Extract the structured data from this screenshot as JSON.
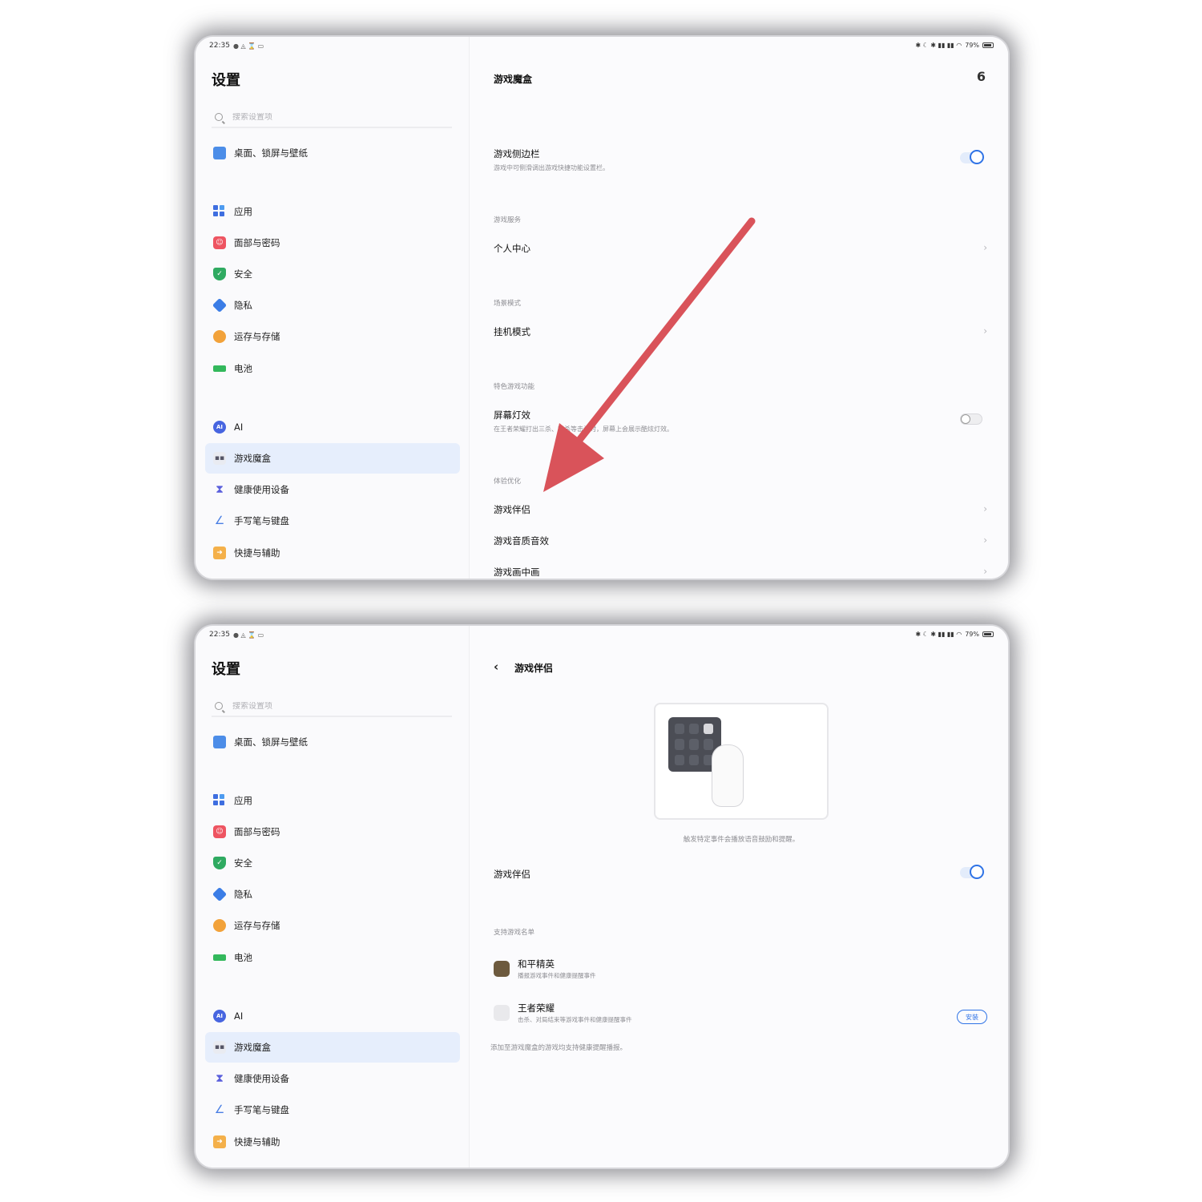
{
  "status": {
    "time": "22:35",
    "battery": "79%"
  },
  "sidebar": {
    "title": "设置",
    "search_placeholder": "搜索设置项",
    "items": [
      {
        "label": "桌面、锁屏与壁纸",
        "icon": "wallpaper-icon"
      },
      {
        "label": "应用",
        "icon": "apps-icon"
      },
      {
        "label": "面部与密码",
        "icon": "face-icon"
      },
      {
        "label": "安全",
        "icon": "shield-icon"
      },
      {
        "label": "隐私",
        "icon": "privacy-icon"
      },
      {
        "label": "运存与存储",
        "icon": "storage-icon"
      },
      {
        "label": "电池",
        "icon": "battery-icon"
      },
      {
        "label": "AI",
        "icon": "ai-icon"
      },
      {
        "label": "游戏魔盒",
        "icon": "gamepad-icon"
      },
      {
        "label": "健康使用设备",
        "icon": "hourglass-icon"
      },
      {
        "label": "手写笔与键盘",
        "icon": "pen-icon"
      },
      {
        "label": "快捷与辅助",
        "icon": "assist-icon"
      }
    ],
    "active": "游戏魔盒",
    "ai_badge": "AI"
  },
  "screen1": {
    "title": "游戏魔盒",
    "header_icon": "6",
    "sidebar_row": {
      "title": "游戏侧边栏",
      "sub": "游戏中可侧滑调出游戏快捷功能设置栏。",
      "toggle": "on"
    },
    "section_service": "游戏服务",
    "personal_center": "个人中心",
    "section_scene": "场景模式",
    "afk_mode": "挂机模式",
    "section_feature": "特色游戏功能",
    "screen_light": {
      "title": "屏幕灯效",
      "sub": "在王者荣耀打出三杀、四杀等击杀时，屏幕上会展示酷炫灯效。",
      "toggle": "off"
    },
    "section_experience": "体验优化",
    "companion": "游戏伴侣",
    "audio": "游戏音质音效",
    "picture": "游戏画中画"
  },
  "screen2": {
    "title": "游戏伴侣",
    "caption": "触发特定事件会播放语音鼓励和提醒。",
    "toggle_row": {
      "title": "游戏伴侣",
      "toggle": "on"
    },
    "section_supported": "支持游戏名单",
    "games": [
      {
        "name": "和平精英",
        "desc": "播报游戏事件和健康提醒事件"
      },
      {
        "name": "王者荣耀",
        "desc": "击杀、对局结束等游戏事件和健康提醒事件",
        "button": "安装"
      }
    ],
    "footnote": "添加至游戏魔盒的游戏均支持健康提醒播报。"
  },
  "colors": {
    "accent": "#2f73e6",
    "active_bg": "#e6eefc",
    "arrow": "#d9535a"
  }
}
